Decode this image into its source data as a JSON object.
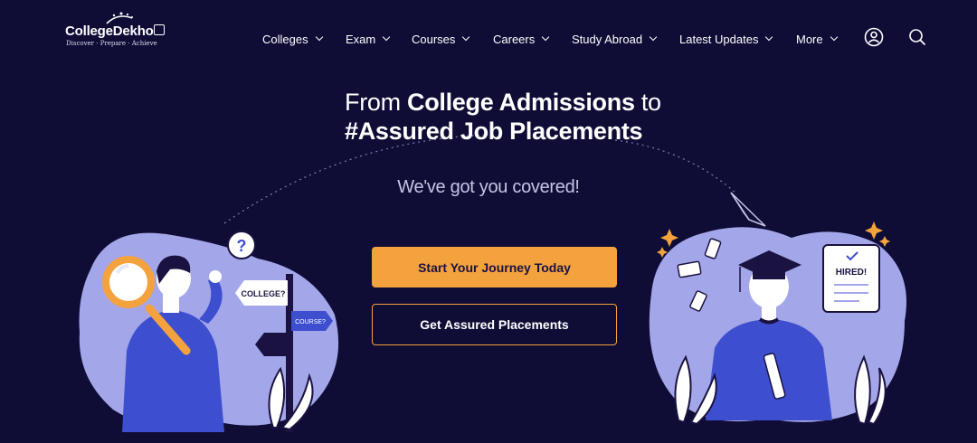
{
  "brand": {
    "name": "CollegeDekho",
    "tagline": "Discover · Prepare · Achieve"
  },
  "nav": {
    "items": [
      {
        "label": "Colleges"
      },
      {
        "label": "Exam"
      },
      {
        "label": "Courses"
      },
      {
        "label": "Careers"
      },
      {
        "label": "Study Abroad"
      },
      {
        "label": "Latest Updates"
      },
      {
        "label": "More"
      }
    ]
  },
  "hero": {
    "line1_prefix": "From ",
    "line1_bold": "College Admissions",
    "line1_suffix": " to",
    "line2_bold": "#Assured Job Placements",
    "subtitle": "We've got you covered!",
    "primary_cta": "Start Your Journey Today",
    "secondary_cta": "Get Assured Placements"
  },
  "left_illustration": {
    "sign_college": "COLLEGE?",
    "sign_course": "COURSE?",
    "question_mark": "?"
  },
  "right_illustration": {
    "hired_text": "HIRED!"
  },
  "colors": {
    "background": "#0f0c36",
    "accent_orange": "#f4a23e",
    "blob_purple": "#a3a6e8",
    "figure_blue": "#3d4fcf"
  }
}
